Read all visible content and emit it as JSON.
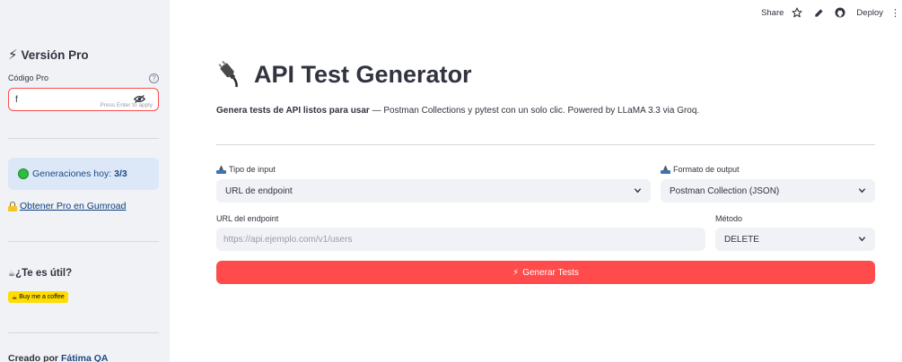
{
  "topbar": {
    "share": "Share",
    "deploy": "Deploy"
  },
  "sidebar": {
    "title": "Versión Pro",
    "code_label": "Código Pro",
    "code_value": "f",
    "code_hint": "Press Enter to apply",
    "generations_label": "Generaciones hoy:",
    "generations_value": "3/3",
    "gumroad_link": "Obtener Pro en Gumroad",
    "useful_title": "¿Te es útil?",
    "coffee_label": "Buy me a coffee",
    "credit_prefix": "Creado por",
    "credit_name": "Fátima QA"
  },
  "main": {
    "title": "API Test Generator",
    "subtitle_bold": "Genera tests de API listos para usar",
    "subtitle_rest": " — Postman Collections y pytest con un solo clic. Powered by LLaMA 3.3 via Groq.",
    "input_type_label": "Tipo de input",
    "input_type_value": "URL de endpoint",
    "output_format_label": "Formato de output",
    "output_format_value": "Postman Collection (JSON)",
    "endpoint_label": "URL del endpoint",
    "endpoint_placeholder": "https://api.ejemplo.com/v1/users",
    "method_label": "Método",
    "method_value": "DELETE",
    "generate_button": "Generar Tests"
  },
  "colors": {
    "primary": "#ff4b4b",
    "sidebar_bg": "#f0f2f6",
    "info_bg": "#dce8f7",
    "success": "#2ebd3e"
  }
}
